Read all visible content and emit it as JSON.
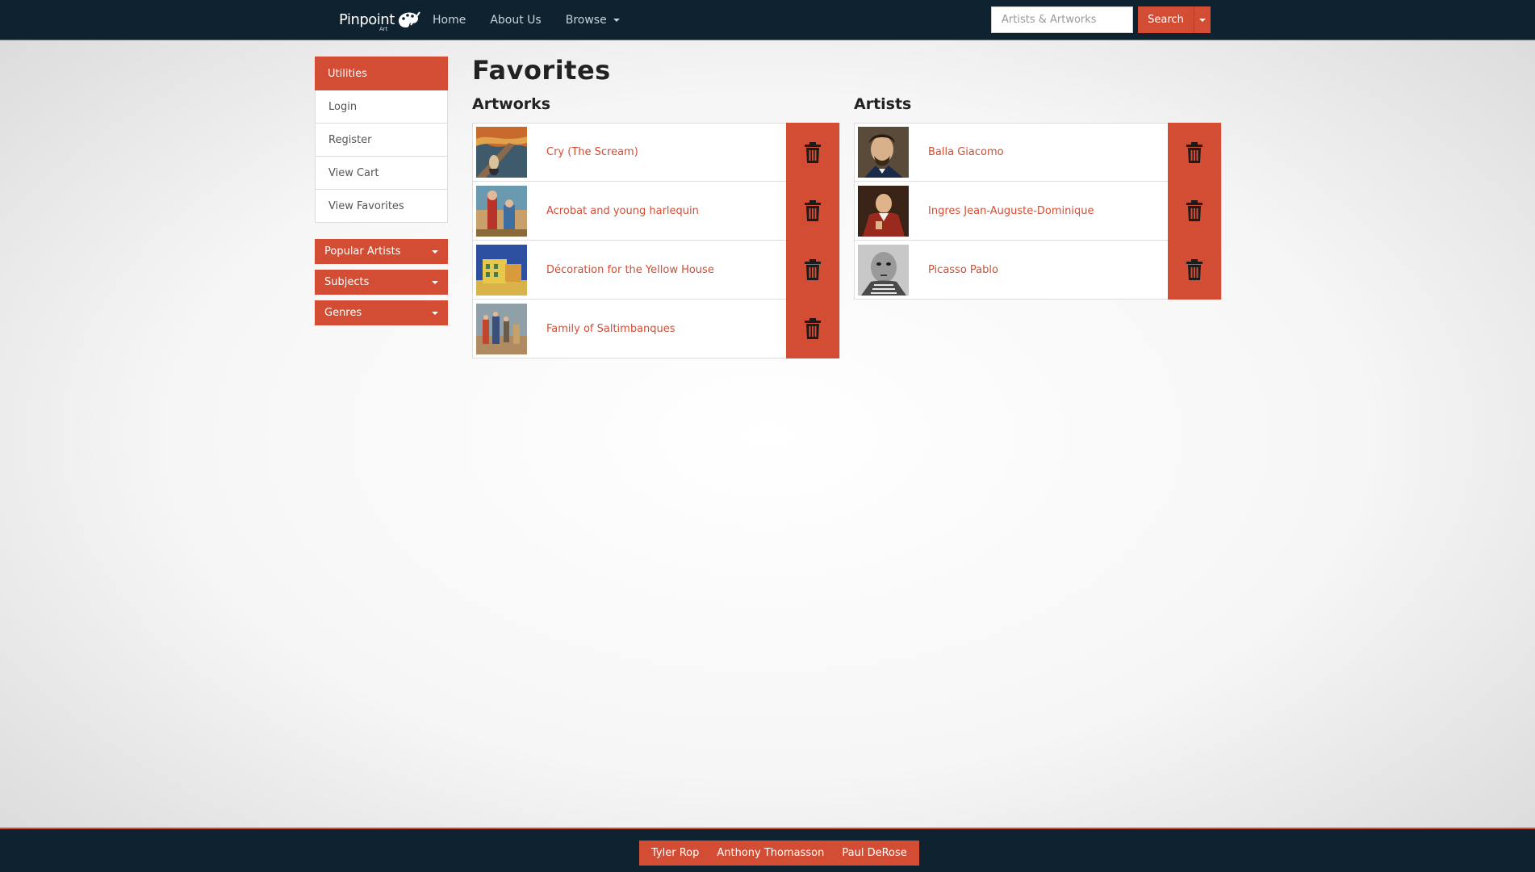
{
  "nav": {
    "brand": "Pinpoint",
    "brand_sub": "Art",
    "links": [
      {
        "label": "Home"
      },
      {
        "label": "About Us"
      },
      {
        "label": "Browse"
      }
    ],
    "search_placeholder": "Artists & Artworks",
    "search_label": "Search"
  },
  "sidebar": {
    "header": "Utilities",
    "items": [
      {
        "label": "Login"
      },
      {
        "label": "Register"
      },
      {
        "label": "View Cart"
      },
      {
        "label": "View Favorites"
      }
    ],
    "dropdowns": [
      {
        "label": "Popular Artists"
      },
      {
        "label": "Subjects"
      },
      {
        "label": "Genres"
      }
    ]
  },
  "main": {
    "title": "Favorites",
    "artworks_title": "Artworks",
    "artists_title": "Artists",
    "artworks": [
      {
        "title": "Cry (The Scream)",
        "thumb": "scream-painting"
      },
      {
        "title": "Acrobat and young harlequin",
        "thumb": "harlequin-painting"
      },
      {
        "title": "Décoration for the Yellow House",
        "thumb": "yellow-house-painting"
      },
      {
        "title": "Family of Saltimbanques",
        "thumb": "saltimbanques-painting"
      }
    ],
    "artists": [
      {
        "name": "Balla Giacomo",
        "thumb": "balla-portrait"
      },
      {
        "name": "Ingres Jean-Auguste-Dominique",
        "thumb": "ingres-portrait"
      },
      {
        "name": "Picasso Pablo",
        "thumb": "picasso-photo"
      }
    ]
  },
  "footer": {
    "names": [
      "Tyler Rop",
      "Anthony Thomasson",
      "Paul DeRose"
    ]
  },
  "colors": {
    "accent": "#d24d33",
    "navbar": "#0e2230"
  }
}
